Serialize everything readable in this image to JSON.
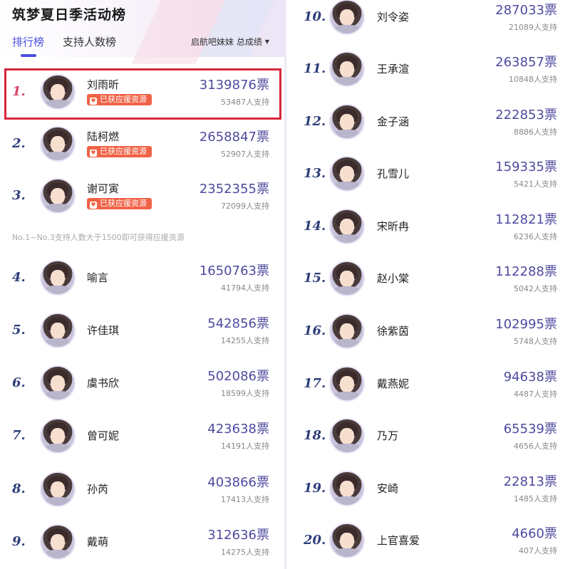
{
  "header": {
    "title": "筑梦夏日季活动榜",
    "tabs": [
      {
        "label": "排行榜",
        "active": true
      },
      {
        "label": "支持人数榜",
        "active": false
      }
    ],
    "filter_label": "启航吧妹妹 总成绩"
  },
  "badge_label": "已获应援资源",
  "note": "No.1~No.3支持人数大于1500即可获得应援资源",
  "colors": {
    "accent": "#4b4fe0",
    "vote": "#4e4a9e",
    "badge": "#f06246",
    "highlight_border": "#d6283d",
    "rank1": "#d8436a"
  },
  "ranking": [
    {
      "rank": "1.",
      "name": "刘雨昕",
      "votes": "3139876票",
      "supporters": "53487人支持",
      "badge": true
    },
    {
      "rank": "2.",
      "name": "陆柯燃",
      "votes": "2658847票",
      "supporters": "52907人支持",
      "badge": true
    },
    {
      "rank": "3.",
      "name": "谢可寅",
      "votes": "2352355票",
      "supporters": "72099人支持",
      "badge": true
    },
    {
      "rank": "4.",
      "name": "喻言",
      "votes": "1650763票",
      "supporters": "41794人支持",
      "badge": false
    },
    {
      "rank": "5.",
      "name": "许佳琪",
      "votes": "542856票",
      "supporters": "14255人支持",
      "badge": false
    },
    {
      "rank": "6.",
      "name": "虞书欣",
      "votes": "502086票",
      "supporters": "18599人支持",
      "badge": false
    },
    {
      "rank": "7.",
      "name": "曾可妮",
      "votes": "423638票",
      "supporters": "14191人支持",
      "badge": false
    },
    {
      "rank": "8.",
      "name": "孙芮",
      "votes": "403866票",
      "supporters": "17413人支持",
      "badge": false
    },
    {
      "rank": "9.",
      "name": "戴萌",
      "votes": "312636票",
      "supporters": "14275人支持",
      "badge": false
    },
    {
      "rank": "10.",
      "name": "刘令姿",
      "votes": "287033票",
      "supporters": "21089人支持",
      "badge": false
    },
    {
      "rank": "11.",
      "name": "王承渲",
      "votes": "263857票",
      "supporters": "10848人支持",
      "badge": false
    },
    {
      "rank": "12.",
      "name": "金子涵",
      "votes": "222853票",
      "supporters": "8886人支持",
      "badge": false
    },
    {
      "rank": "13.",
      "name": "孔雪儿",
      "votes": "159335票",
      "supporters": "5421人支持",
      "badge": false
    },
    {
      "rank": "14.",
      "name": "宋昕冉",
      "votes": "112821票",
      "supporters": "6236人支持",
      "badge": false
    },
    {
      "rank": "15.",
      "name": "赵小棠",
      "votes": "112288票",
      "supporters": "5042人支持",
      "badge": false
    },
    {
      "rank": "16.",
      "name": "徐紫茵",
      "votes": "102995票",
      "supporters": "5748人支持",
      "badge": false
    },
    {
      "rank": "17.",
      "name": "戴燕妮",
      "votes": "94638票",
      "supporters": "4487人支持",
      "badge": false
    },
    {
      "rank": "18.",
      "name": "乃万",
      "votes": "65539票",
      "supporters": "4656人支持",
      "badge": false
    },
    {
      "rank": "19.",
      "name": "安崎",
      "votes": "22813票",
      "supporters": "1485人支持",
      "badge": false
    },
    {
      "rank": "20.",
      "name": "上官喜爱",
      "votes": "4660票",
      "supporters": "407人支持",
      "badge": false
    }
  ]
}
